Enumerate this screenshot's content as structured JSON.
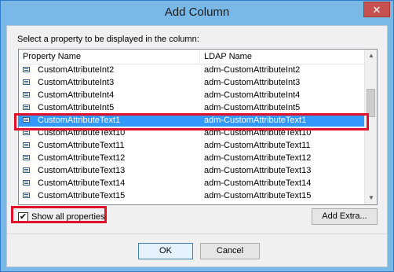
{
  "window": {
    "title": "Add Column",
    "close_glyph": "✕"
  },
  "instruction": "Select a property to be displayed in the column:",
  "columns": {
    "property": "Property Name",
    "ldap": "LDAP Name"
  },
  "rows": [
    {
      "property": "CustomAttributeInt2",
      "ldap": "adm-CustomAttributeInt2"
    },
    {
      "property": "CustomAttributeInt3",
      "ldap": "adm-CustomAttributeInt3"
    },
    {
      "property": "CustomAttributeInt4",
      "ldap": "adm-CustomAttributeInt4"
    },
    {
      "property": "CustomAttributeInt5",
      "ldap": "adm-CustomAttributeInt5"
    },
    {
      "property": "CustomAttributeText1",
      "ldap": "adm-CustomAttributeText1"
    },
    {
      "property": "CustomAttributeText10",
      "ldap": "adm-CustomAttributeText10"
    },
    {
      "property": "CustomAttributeText11",
      "ldap": "adm-CustomAttributeText11"
    },
    {
      "property": "CustomAttributeText12",
      "ldap": "adm-CustomAttributeText12"
    },
    {
      "property": "CustomAttributeText13",
      "ldap": "adm-CustomAttributeText13"
    },
    {
      "property": "CustomAttributeText14",
      "ldap": "adm-CustomAttributeText14"
    },
    {
      "property": "CustomAttributeText15",
      "ldap": "adm-CustomAttributeText15"
    }
  ],
  "selected_row": 4,
  "show_all": {
    "label": "Show all properties",
    "checked": true,
    "check_glyph": "✔"
  },
  "buttons": {
    "add_extra": "Add Extra...",
    "ok": "OK",
    "cancel": "Cancel"
  },
  "scroll_glyphs": {
    "up": "▲",
    "down": "▼"
  },
  "colors": {
    "selection": "#3399ff",
    "highlight": "#e0102a",
    "titlebar": "#7ab8e8",
    "close": "#c75050"
  }
}
